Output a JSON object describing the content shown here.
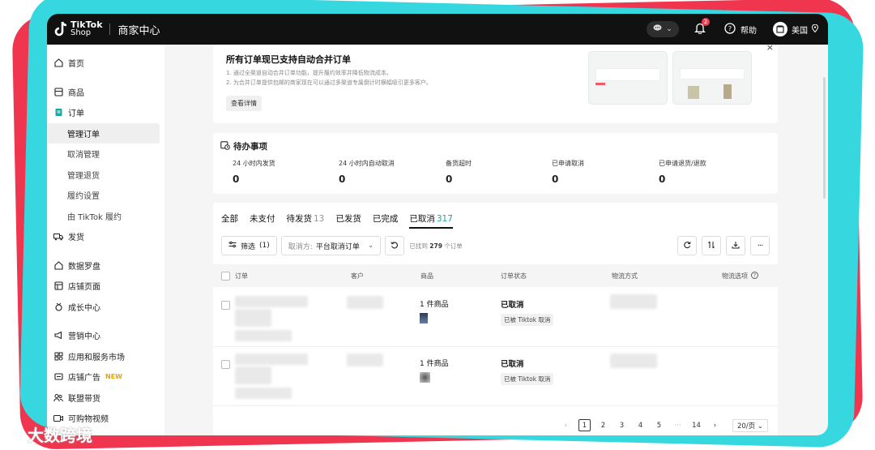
{
  "header": {
    "brand_line1": "TikTok",
    "brand_line2": "Shop",
    "title": "商家中心",
    "notification_count": "2",
    "help_label": "帮助",
    "region_label": "美国"
  },
  "sidebar": {
    "home": "首页",
    "products": "商品",
    "orders": "订单",
    "orders_sub": [
      "管理订单",
      "取消管理",
      "管理退货",
      "履约设置",
      "由 TikTok 履约"
    ],
    "shipping": "发货",
    "data_compass": "数据罗盘",
    "store_page": "店铺页面",
    "growth": "成长中心",
    "marketing": "营销中心",
    "apps": "应用和服务市场",
    "store_ads": "店铺广告",
    "store_ads_badge": "NEW",
    "affiliate": "联盟带货",
    "shoppable_video": "可购物视频"
  },
  "banner": {
    "title": "所有订单现已支持自动合并订单",
    "line1": "1. 通过全渠道自动合并订单功能，提升履约效率并降低物流成本。",
    "line2": "2. 为合并订单提供包邮的商家现在可以通过多渠道专属倒计时横幅吸引更多客户。",
    "button": "查看详情"
  },
  "todo": {
    "title": "待办事项",
    "items": [
      {
        "label": "24 小时内发货",
        "value": "0"
      },
      {
        "label": "24 小时内自动取消",
        "value": "0"
      },
      {
        "label": "备货超时",
        "value": "0"
      },
      {
        "label": "已申请取消",
        "value": "0"
      },
      {
        "label": "已申请退货/退款",
        "value": "0"
      }
    ]
  },
  "orders": {
    "tabs": [
      {
        "label": "全部",
        "count": ""
      },
      {
        "label": "未支付",
        "count": ""
      },
      {
        "label": "待发货",
        "count": "13"
      },
      {
        "label": "已发货",
        "count": ""
      },
      {
        "label": "已完成",
        "count": ""
      },
      {
        "label": "已取消",
        "count": "317"
      }
    ],
    "filter_label": "筛选",
    "filter_count": "(1)",
    "select_prefix": "取消方:",
    "select_value": "平台取消订单",
    "found_prefix": "已找到",
    "found_count": "279",
    "found_suffix": "个订单",
    "columns": [
      "订单",
      "客户",
      "商品",
      "订单状态",
      "物流方式",
      "物流选项"
    ],
    "rows": [
      {
        "items": "1 件商品",
        "status": "已取消",
        "status_note": "已被 Tiktok 取消"
      },
      {
        "items": "1 件商品",
        "status": "已取消",
        "status_note": "已被 Tiktok 取消"
      }
    ]
  },
  "pagination": {
    "pages": [
      "1",
      "2",
      "3",
      "4",
      "5",
      "···",
      "14"
    ],
    "page_size": "20/页"
  },
  "watermark": "大数跨境"
}
